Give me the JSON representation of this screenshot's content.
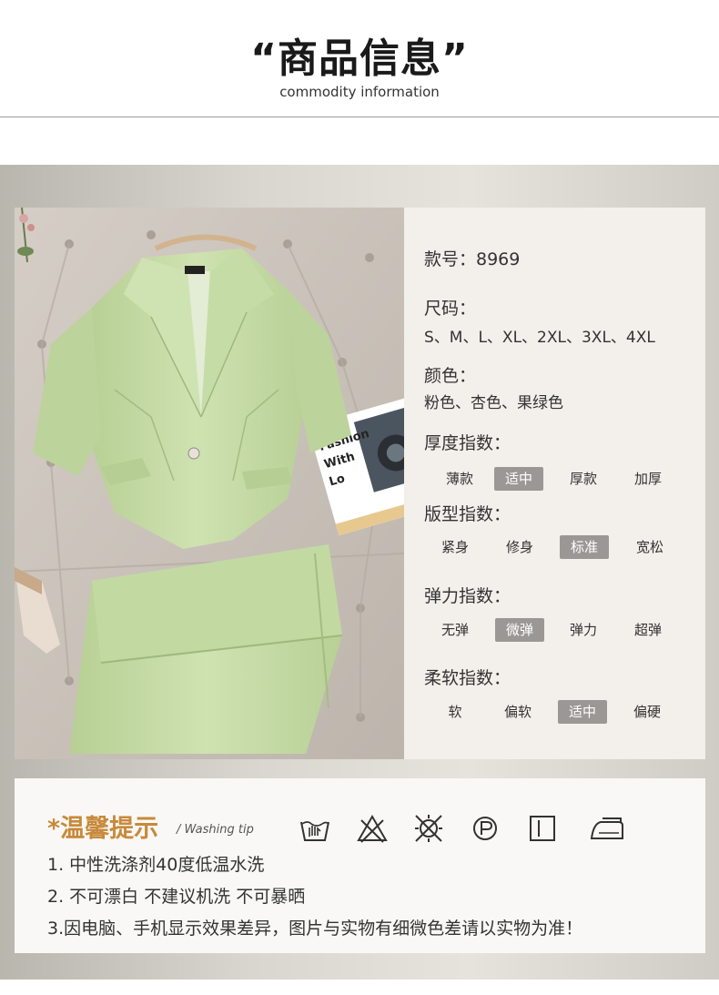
{
  "header": {
    "title": "“商品信息”",
    "subtitle": "commodity information"
  },
  "photo": {
    "magazine_text": [
      "Fashion",
      "With",
      "Lo"
    ]
  },
  "specs": {
    "style_no": "款号：8969",
    "size_label": "尺码：",
    "sizes": "S、M、L、XL、2XL、3XL、4XL",
    "color_label": "颜色：",
    "colors": "粉色、杏色、果绿色",
    "indices": [
      {
        "label": "厚度指数：",
        "options": [
          "薄款",
          "适中",
          "厚款",
          "加厚"
        ],
        "selected": "适中"
      },
      {
        "label": "版型指数：",
        "options": [
          "紧身",
          "修身",
          "标准",
          "宽松"
        ],
        "selected": "标准"
      },
      {
        "label": "弹力指数：",
        "options": [
          "无弹",
          "微弹",
          "弹力",
          "超弹"
        ],
        "selected": "微弹"
      },
      {
        "label": "柔软指数：",
        "options": [
          "软",
          "偏软",
          "适中",
          "偏硬"
        ],
        "selected": "适中"
      }
    ]
  },
  "care": {
    "title": "*温馨提示",
    "subtitle": "/ Washing tip",
    "title_color": "#c8893a",
    "icons": [
      "hand-wash-40-icon",
      "do-not-bleach-icon",
      "do-not-tumble-dry-icon",
      "dry-clean-p-icon",
      "drip-dry-icon",
      "low-iron-icon"
    ],
    "lines": [
      "1. 中性洗涤剂40度低温水洗",
      "2. 不可漂白 不建议机洗 不可暴晒",
      "3.因电脑、手机显示效果差异，图片与实物有细微色差请以实物为准！"
    ]
  },
  "colors": {
    "selected_option_bg": "#9b9795",
    "spec_panel_bg": "#f3efea",
    "garment_green": "#c8dca8"
  }
}
